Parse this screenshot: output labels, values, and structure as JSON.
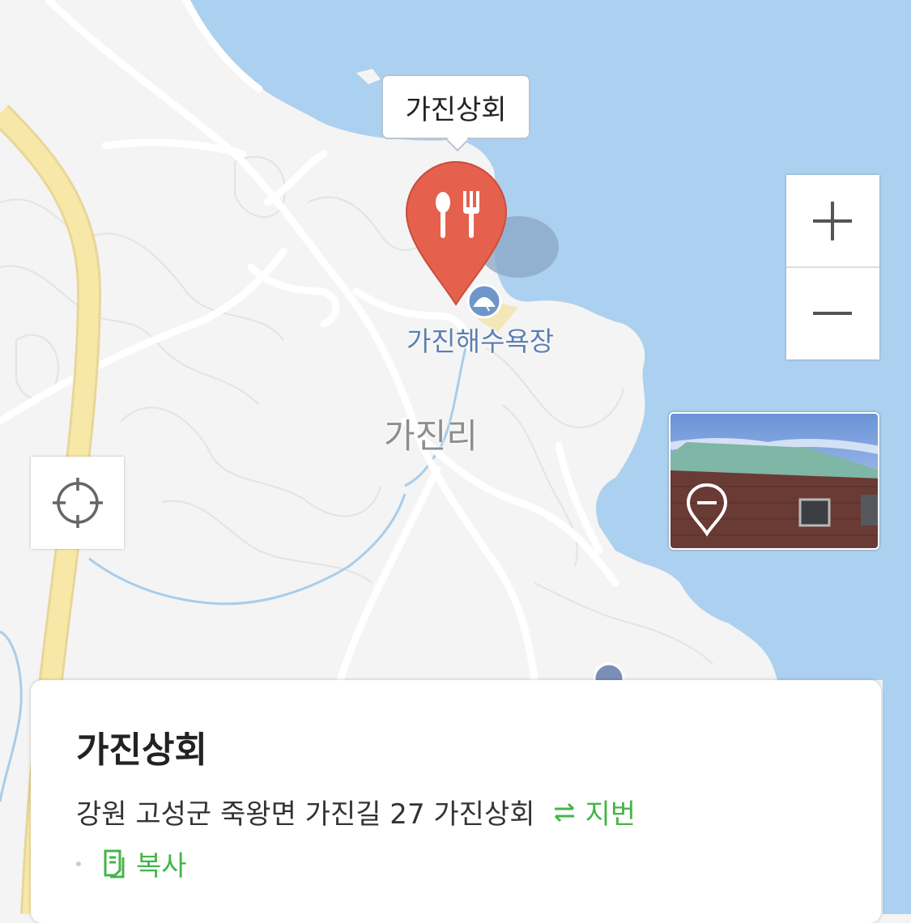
{
  "map": {
    "callout_label": "가진상회",
    "beach_label": "가진해수욕장",
    "village_label": "가진리",
    "marker_icon": "restaurant-icon",
    "colors": {
      "sea": "#acd0ef",
      "land": "#f4f4f4",
      "highway": "#f8e8a8",
      "marker": "#e5614d",
      "stream": "#a8cdea"
    }
  },
  "controls": {
    "zoom_in_icon": "plus-icon",
    "zoom_out_icon": "minus-icon",
    "locate_icon": "crosshair-icon",
    "roadview_icon": "roadview-pin-icon"
  },
  "place": {
    "name": "가진상회",
    "address": "강원 고성군 죽왕면 가진길 27 가진상회",
    "jibun_label": "지번",
    "copy_label": "복사",
    "accent_color": "#45b549"
  }
}
